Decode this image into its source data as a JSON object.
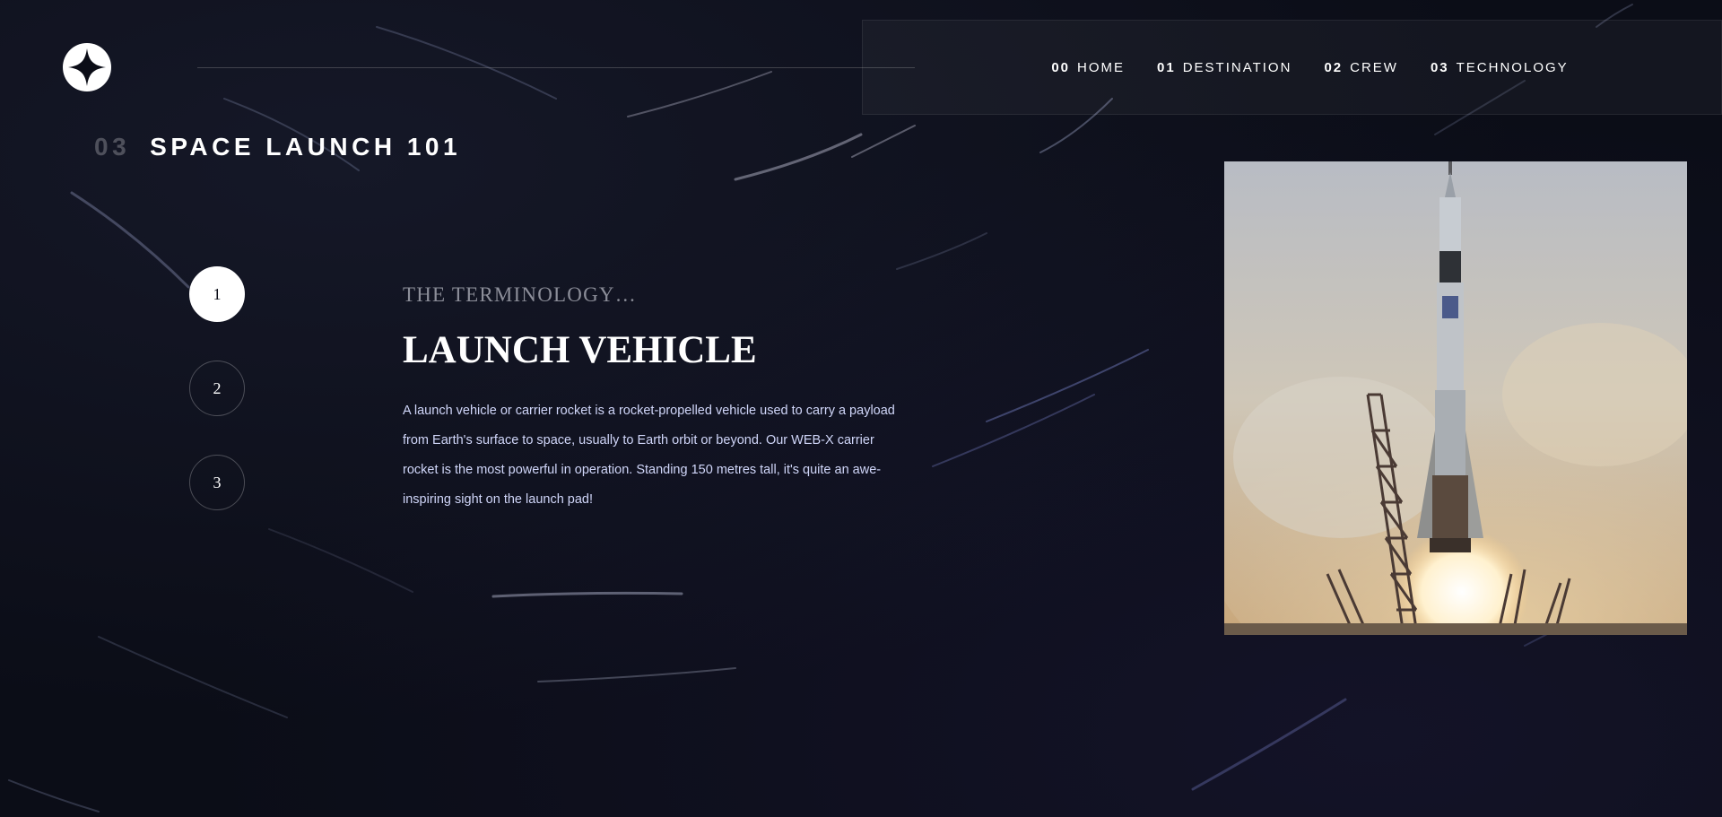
{
  "nav": {
    "items": [
      {
        "num": "00",
        "label": "HOME"
      },
      {
        "num": "01",
        "label": "DESTINATION"
      },
      {
        "num": "02",
        "label": "CREW"
      },
      {
        "num": "03",
        "label": "TECHNOLOGY"
      }
    ]
  },
  "page": {
    "num": "03",
    "title": "SPACE LAUNCH 101"
  },
  "steps": [
    "1",
    "2",
    "3"
  ],
  "active_step": "1",
  "content": {
    "eyebrow": "THE TERMINOLOGY…",
    "title": "LAUNCH VEHICLE",
    "description": "A launch vehicle or carrier rocket is a rocket-propelled vehicle used to carry a payload from Earth's surface to space, usually to Earth orbit or beyond. Our WEB-X carrier rocket is the most powerful in operation. Standing 150 metres tall, it's quite an awe-inspiring sight on the launch pad!"
  },
  "colors": {
    "background": "#0b0d17",
    "accent_text": "#d0d6f9",
    "muted": "#8c8e99"
  }
}
